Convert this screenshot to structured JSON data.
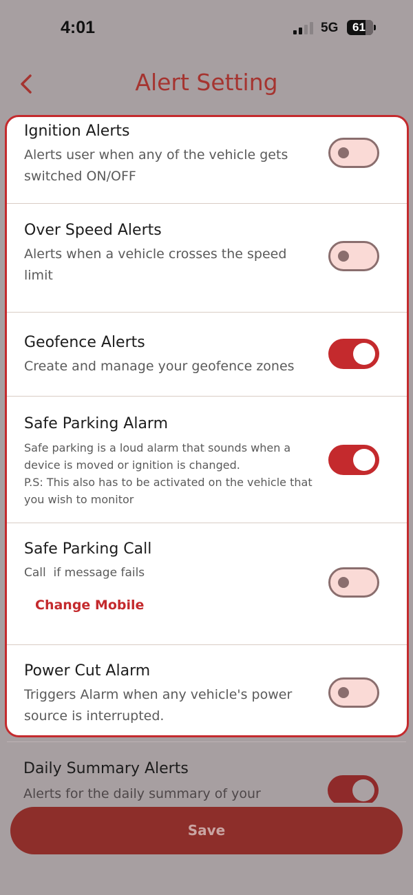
{
  "status_bar": {
    "time": "4:01",
    "network": "5G",
    "battery": "61"
  },
  "header": {
    "title": "Alert Setting"
  },
  "alerts": [
    {
      "title": "Ignition Alerts",
      "description": "Alerts user when any of the vehicle gets switched ON/OFF",
      "enabled": false
    },
    {
      "title": "Over Speed Alerts",
      "description": "Alerts when a vehicle crosses the speed limit",
      "enabled": false
    },
    {
      "title": "Geofence Alerts",
      "description": "Create and manage your geofence zones",
      "enabled": true
    },
    {
      "title": "Safe Parking Alarm",
      "description": "Safe parking is a loud alarm that sounds when a device is moved or ignition is changed.\nP.S: This also has to be activated on the vehicle that you wish to monitor",
      "enabled": true
    },
    {
      "title": "Safe Parking Call",
      "description": "Call  if message fails",
      "link": "Change Mobile",
      "enabled": false
    },
    {
      "title": "Power Cut Alarm",
      "description": "Triggers Alarm when any vehicle's power source is interrupted.",
      "enabled": false
    },
    {
      "title": "Daily Summary Alerts",
      "description": "Alerts for the daily summary of your",
      "enabled": true
    }
  ],
  "footer": {
    "save_label": "Save"
  },
  "colors": {
    "accent": "#c42a2d",
    "title": "#a53430",
    "overlay": "#a79fa1"
  }
}
